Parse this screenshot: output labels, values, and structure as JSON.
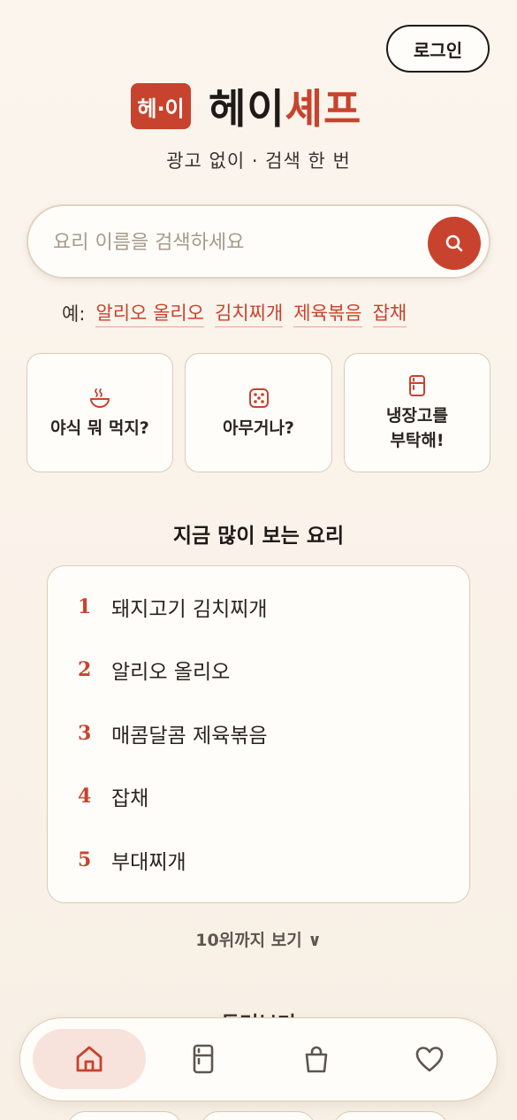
{
  "header": {
    "login_label": "로그인",
    "logo_badge": "헤·이",
    "logo_title_part1": "헤이",
    "logo_title_part2": "셰프",
    "tagline": "광고 없이 · 검색 한 번"
  },
  "search": {
    "placeholder": "요리 이름을 검색하세요",
    "value": "",
    "button_icon": "search-icon"
  },
  "examples": {
    "label": "예:",
    "chips": [
      "알리오 올리오",
      "김치찌개",
      "제육볶음",
      "잡채"
    ]
  },
  "actions": [
    {
      "label": "야식 뭐 먹지?",
      "icon": "steaming-bowl-icon"
    },
    {
      "label": "아무거나?",
      "icon": "dice-icon"
    },
    {
      "label": "냉장고를\n부탁해!",
      "icon": "fridge-icon"
    }
  ],
  "popular": {
    "title": "지금 많이 보는 요리",
    "items": [
      {
        "rank": "1",
        "name": "돼지고기 김치찌개"
      },
      {
        "rank": "2",
        "name": "알리오 올리오"
      },
      {
        "rank": "3",
        "name": "매콤달콤 제육볶음"
      },
      {
        "rank": "4",
        "name": "잡채"
      },
      {
        "rank": "5",
        "name": "부대찌개"
      }
    ],
    "more_label": "10위까지 보기 ∨"
  },
  "browse": {
    "title": "둘러보기"
  },
  "bottom_nav": {
    "items": [
      {
        "icon": "home-icon",
        "active": true
      },
      {
        "icon": "fridge-icon",
        "active": false
      },
      {
        "icon": "shopping-bag-icon",
        "active": false
      },
      {
        "icon": "heart-icon",
        "active": false
      }
    ]
  },
  "colors": {
    "accent": "#c8432d",
    "background": "#f9f1e7",
    "card": "#fffdf9",
    "border": "#d9ccb7"
  }
}
